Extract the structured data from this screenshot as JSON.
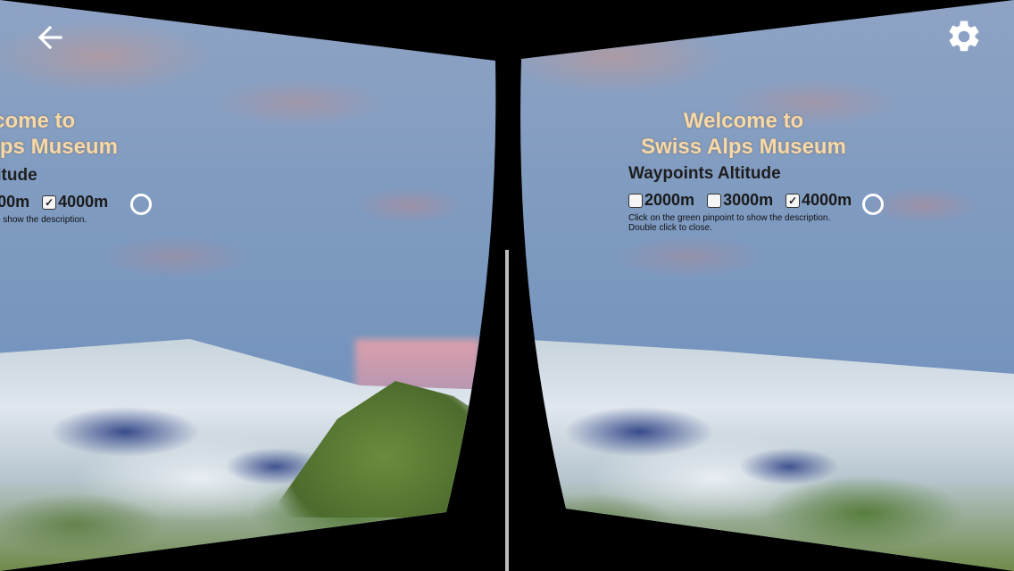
{
  "welcome": {
    "line1": "Welcome to",
    "line2": "Swiss Alps Museum"
  },
  "waypoints": {
    "title": "Waypoints Altitude",
    "options": [
      {
        "label": "2000m",
        "checked": false
      },
      {
        "label": "3000m",
        "checked": false
      },
      {
        "label": "4000m",
        "checked": true
      }
    ],
    "help_line1": "Click on the green pinpoint to show the description.",
    "help_line2": "Double click to close."
  },
  "toolbar": {
    "back_icon": "arrow-left",
    "settings_icon": "gear"
  },
  "colors": {
    "welcome_text": "#f6d9a8",
    "sky": "#7e9ac0",
    "reticle": "#ffffff"
  }
}
